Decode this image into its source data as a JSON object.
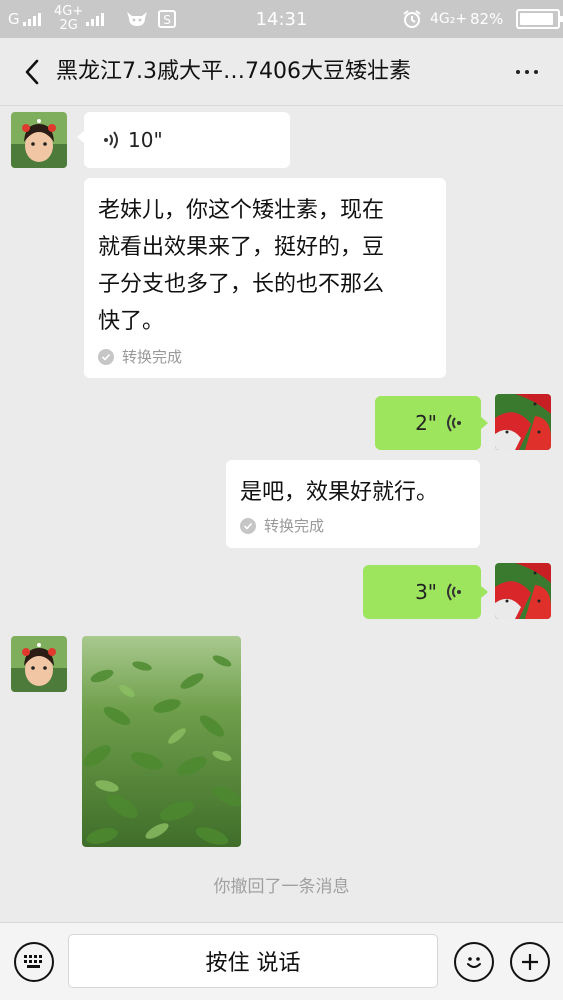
{
  "status_bar": {
    "carrier1": "G",
    "net1": "4G+",
    "net2": "2G",
    "time": "14:31",
    "net3": "4G₂+",
    "battery": "82%"
  },
  "header": {
    "title": "黑龙江7.3戚大平…7406大豆矮壮素"
  },
  "messages": [
    {
      "side": "left",
      "type": "voice",
      "duration": "10\""
    },
    {
      "side": "left",
      "type": "text",
      "lines": [
        "老妹儿，你这个矮壮素，现在",
        "就看出效果来了，挺好的，豆",
        "子分支也多了，长的也不那么",
        "快了。"
      ],
      "status": "转换完成"
    },
    {
      "side": "right",
      "type": "voice",
      "duration": "2\""
    },
    {
      "side": "right",
      "type": "text",
      "text": "是吧，效果好就行。",
      "status": "转换完成"
    },
    {
      "side": "right",
      "type": "voice",
      "duration": "3\""
    },
    {
      "side": "left",
      "type": "image"
    }
  ],
  "system_notice": "你撤回了一条消息",
  "input_bar": {
    "hold_to_talk": "按住 说话",
    "keyboard_icon": "keyboard-icon",
    "emoji_icon": "emoji-icon",
    "plus_icon": "plus-icon"
  },
  "colors": {
    "chat_background": "#ebebeb",
    "own_bubble": "#9de55d",
    "other_bubble": "#ffffff"
  }
}
